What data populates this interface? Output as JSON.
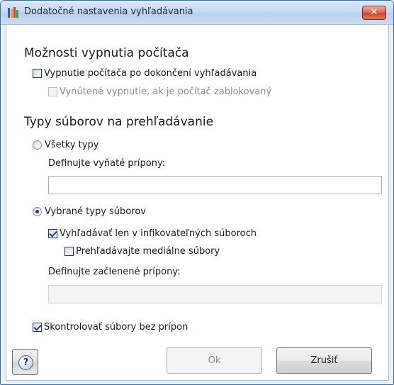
{
  "window": {
    "title": "Dodatočné nastavenia vyhľadávania",
    "close_label": "✕"
  },
  "shutdown": {
    "title": "Možnosti vypnutia počítača",
    "shutdown_after_scan": {
      "label": "Vypnutie počítača po dokončení vyhľadávania",
      "checked": false,
      "enabled": true
    },
    "force_shutdown": {
      "label": "Vynútené vypnutie, ak je počítač zablokovaný",
      "checked": false,
      "enabled": false
    }
  },
  "file_types": {
    "title": "Typy súborov na prehľadávanie",
    "all_types": {
      "label": "Všetky typy",
      "selected": false
    },
    "excluded_ext": {
      "label": "Definujte vyňaté prípony:",
      "value": ""
    },
    "selected_types": {
      "label": "Vybrané typy súborov",
      "selected": true
    },
    "infectable_only": {
      "label": "Vyhľadávať len v infikovateľných súboroch",
      "checked": true
    },
    "media_files": {
      "label": "Prehľadávajte mediálne súbory",
      "checked": false
    },
    "included_ext": {
      "label": "Definujte začlenené prípony:",
      "value": ""
    }
  },
  "no_extension": {
    "label": "Skontrolovať súbory bez prípon",
    "checked": true
  },
  "buttons": {
    "help_icon": "?",
    "ok": "Ok",
    "cancel": "Zrušiť"
  }
}
